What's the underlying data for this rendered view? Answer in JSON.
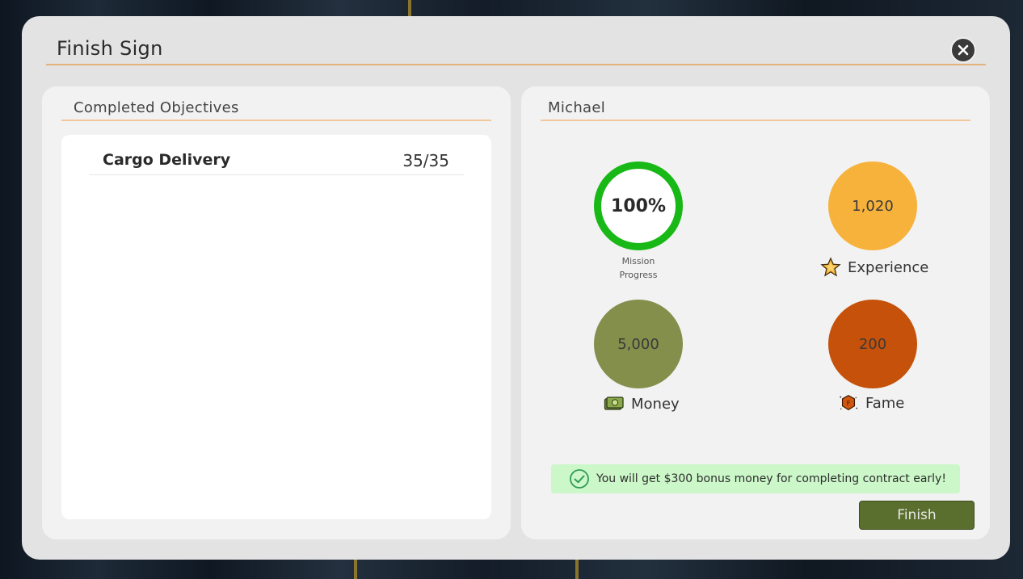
{
  "dialog": {
    "title": "Finish Sign"
  },
  "objectives": {
    "heading": "Completed Objectives",
    "items": [
      {
        "name": "Cargo Delivery",
        "count": "35/35"
      }
    ]
  },
  "summary": {
    "heading": "Michael",
    "mission_progress": {
      "value": "100%",
      "caption_line1": "Mission",
      "caption_line2": "Progress",
      "ring_color": "#18b816"
    },
    "experience": {
      "value": "1,020",
      "label": "Experience",
      "color": "#f7b23b",
      "icon": "star-icon"
    },
    "money": {
      "value": "5,000",
      "label": "Money",
      "color": "#838f4b",
      "icon": "cash-icon"
    },
    "fame": {
      "value": "200",
      "label": "Fame",
      "color": "#c5510a",
      "icon": "fame-badge-icon"
    },
    "bonus_message": "You will get $300 bonus money for completing contract early!",
    "finish_label": "Finish"
  }
}
